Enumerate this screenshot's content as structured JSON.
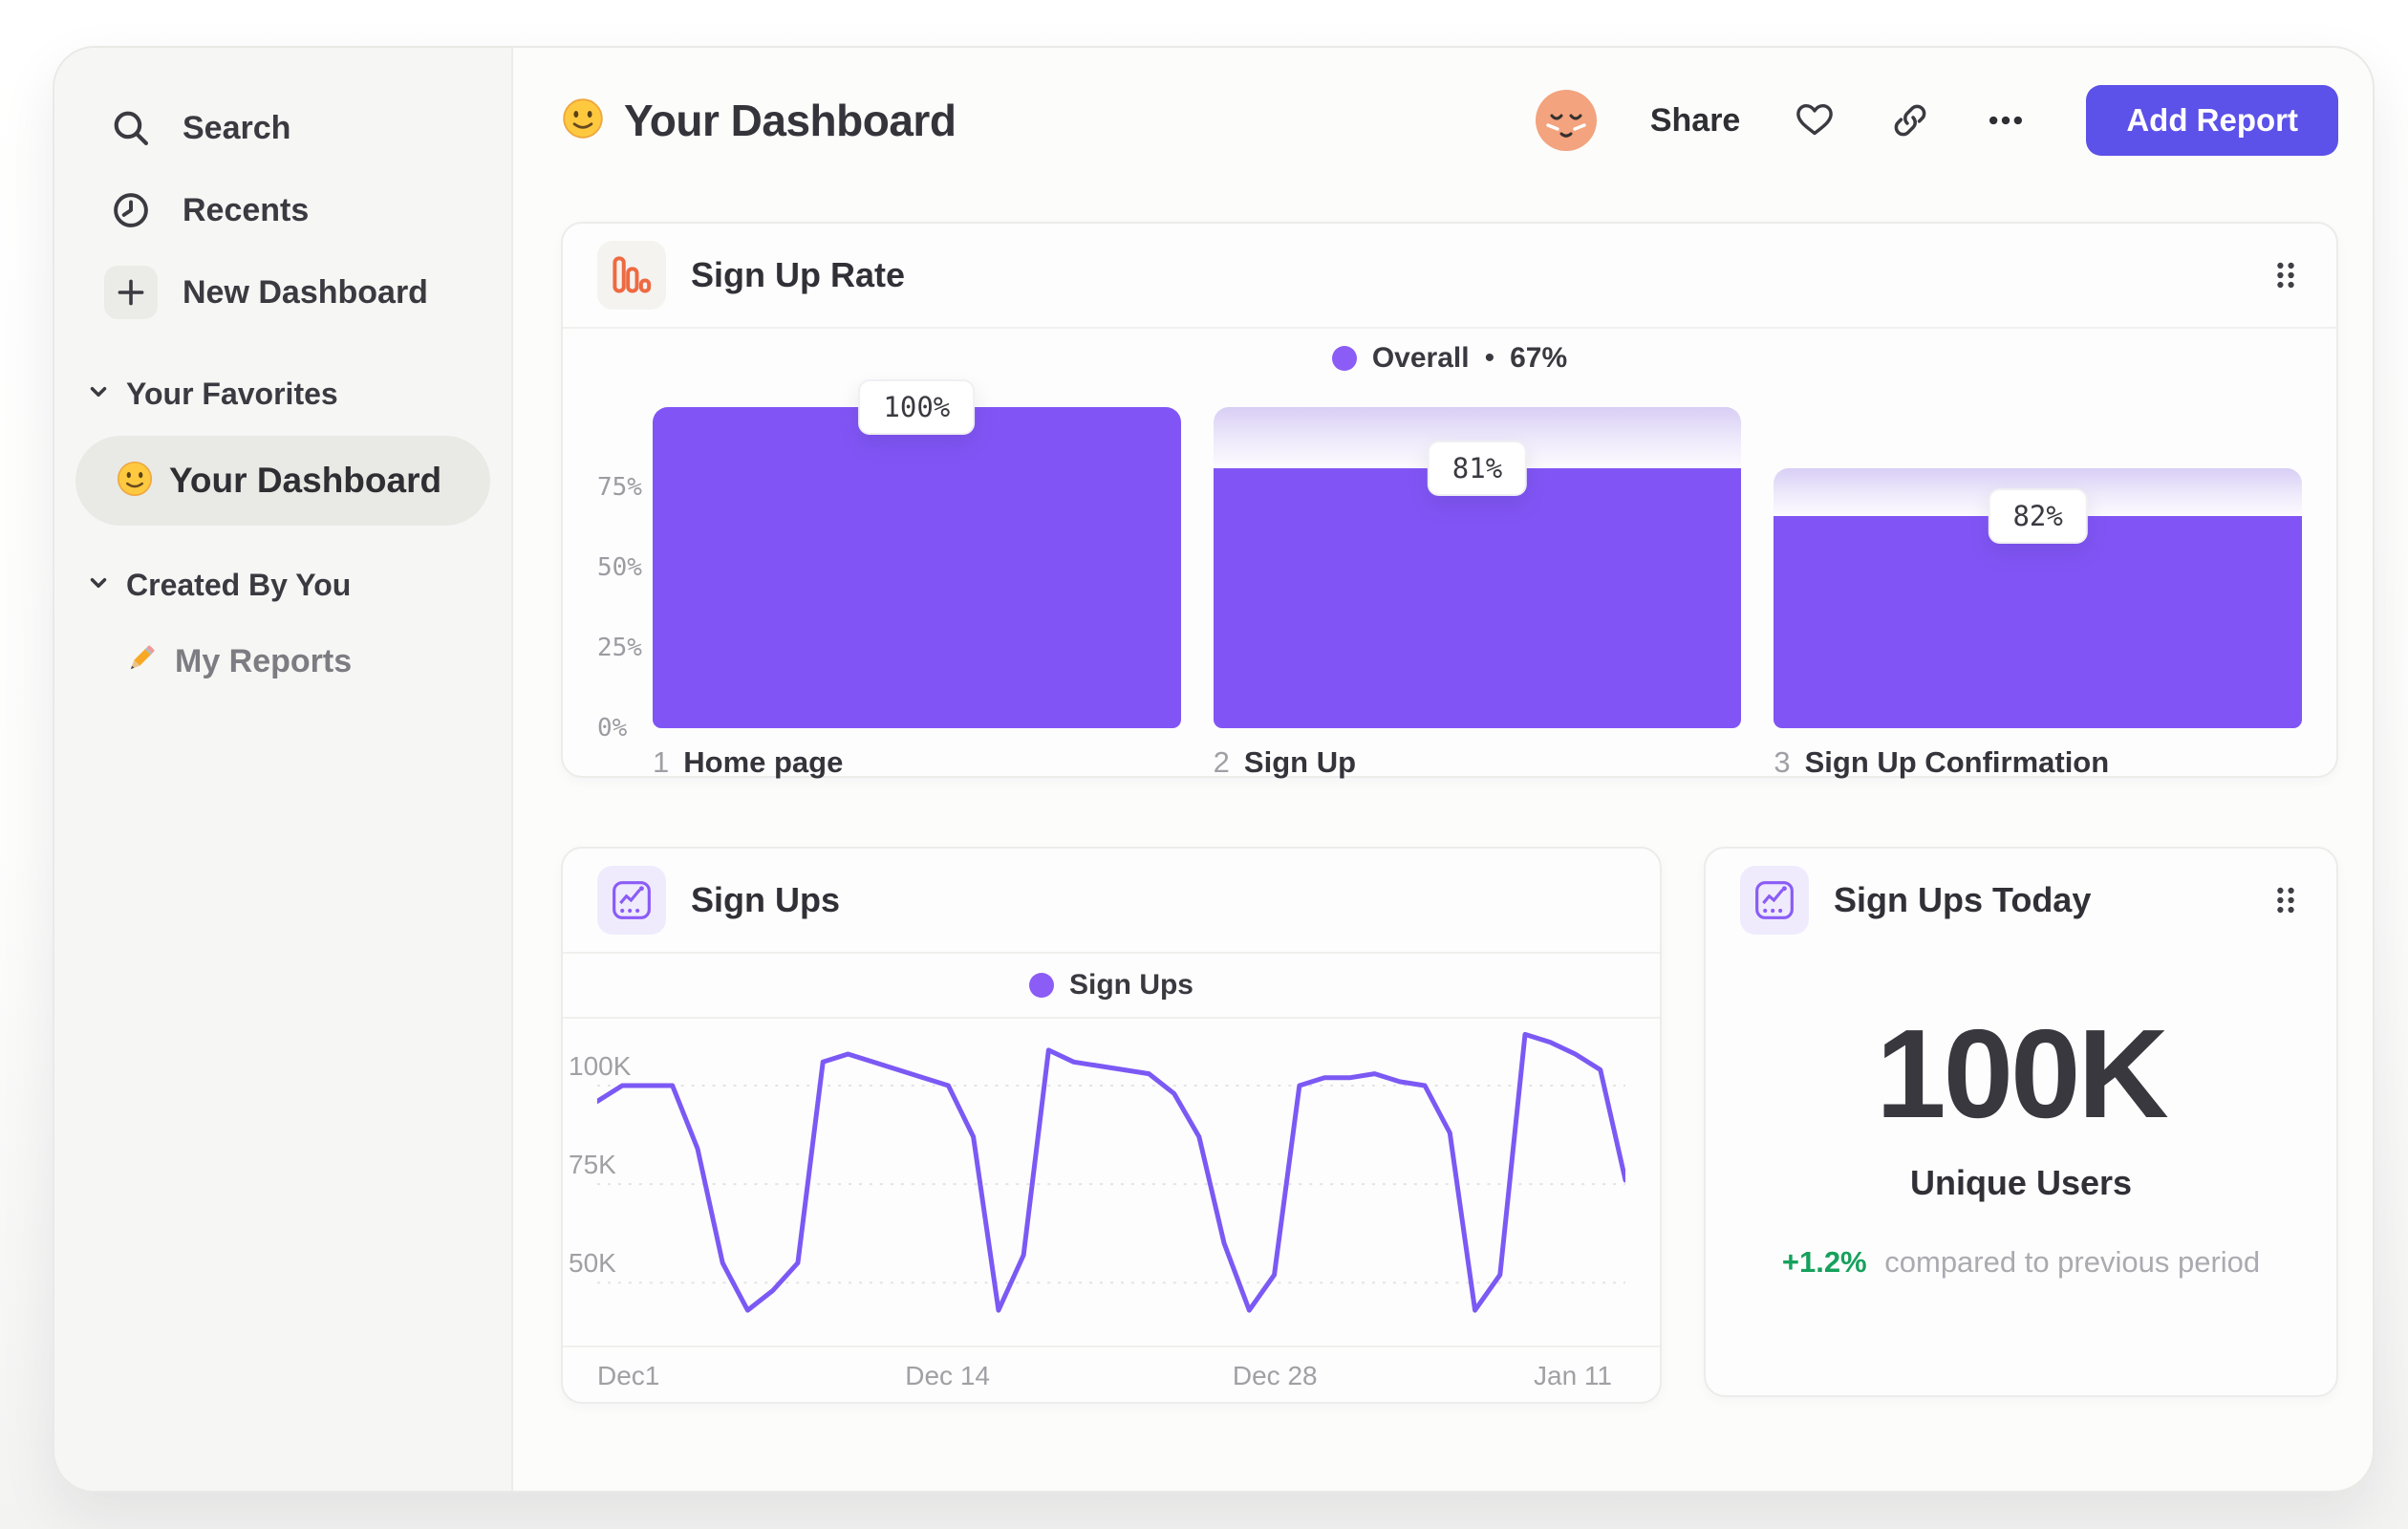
{
  "colors": {
    "accent": "#5c51e8",
    "bar_purple": "#8155f5",
    "line_purple": "#7b59f4",
    "legend_dot": "#8b5cf6",
    "green": "#16a15c",
    "orange_icon": "#ee6a41",
    "purple_icon": "#8b5cf6"
  },
  "sidebar": {
    "nav": [
      {
        "label": "Search"
      },
      {
        "label": "Recents"
      },
      {
        "label": "New Dashboard"
      }
    ],
    "sections": [
      {
        "title": "Your Favorites",
        "items": [
          {
            "label": "Your Dashboard",
            "selected": true
          }
        ]
      },
      {
        "title": "Created By You",
        "items": [
          {
            "label": "My Reports",
            "selected": false
          }
        ]
      }
    ]
  },
  "header": {
    "title": "Your Dashboard",
    "share": "Share",
    "add_report": "Add Report"
  },
  "chart_data": [
    {
      "type": "bar",
      "variant": "funnel",
      "title": "Sign Up Rate",
      "legend": {
        "series": "Overall",
        "sep": "•",
        "overall_conversion": "67%"
      },
      "categories": [
        "Home page",
        "Sign Up",
        "Sign Up Confirmation"
      ],
      "step_labels": [
        "100%",
        "81%",
        "82%"
      ],
      "step_conversion_pct": [
        100,
        81,
        82
      ],
      "cumulative_pct": [
        100,
        81,
        66
      ],
      "y_ticks": [
        "75%",
        "50%",
        "25%",
        "0%"
      ],
      "ylim": [
        0,
        100
      ],
      "grid": false,
      "legend_position": "top-center"
    },
    {
      "type": "line",
      "title": "Sign Ups",
      "legend": "Sign Ups",
      "x_ticks": [
        "Dec1",
        "Dec 14",
        "Dec 28",
        "Jan 11"
      ],
      "y_ticks": [
        "100K",
        "75K",
        "50K"
      ],
      "gridline_values": [
        100,
        75,
        50
      ],
      "ylim": [
        36,
        116
      ],
      "unit": "K",
      "grid": "dashed-horizontal",
      "legend_position": "top-center",
      "values": [
        96,
        100,
        100,
        100,
        84,
        55,
        43,
        48,
        55,
        106,
        108,
        106,
        104,
        102,
        100,
        87,
        43,
        57,
        109,
        106,
        105,
        104,
        103,
        98,
        87,
        60,
        43,
        52,
        100,
        102,
        102,
        103,
        101,
        100,
        88,
        43,
        52,
        113,
        111,
        108,
        104,
        76
      ]
    },
    {
      "type": "metric",
      "title": "Sign Ups Today",
      "value": "100K",
      "label": "Unique Users",
      "delta": "+1.2%",
      "delta_note": "compared to previous period"
    }
  ]
}
